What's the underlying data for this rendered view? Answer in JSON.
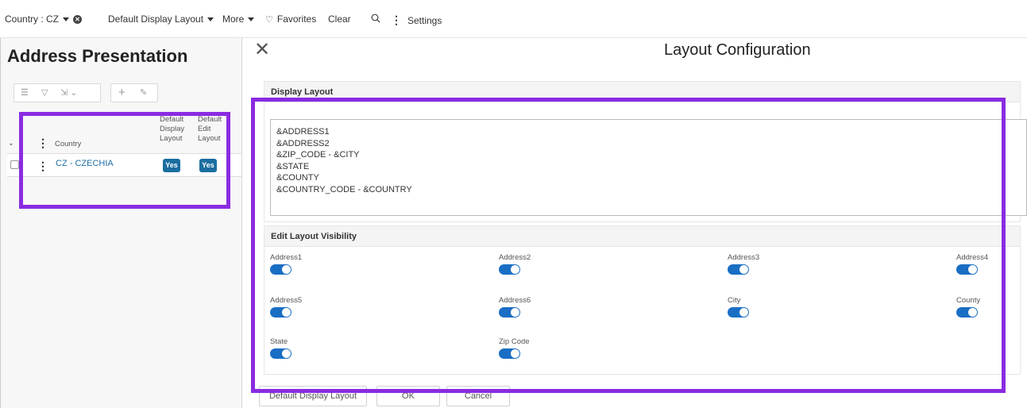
{
  "toolbar": {
    "country_filter": "Country : CZ",
    "layout_menu": "Default Display Layout",
    "more_menu": "More",
    "favorites": "Favorites",
    "clear": "Clear",
    "settings": "Settings"
  },
  "page": {
    "title": "Address Presentation"
  },
  "grid": {
    "columns": {
      "country": "Country",
      "default_display_layout": [
        "Default",
        "Display",
        "Layout"
      ],
      "default_edit_layout": [
        "Default",
        "Edit",
        "Layout"
      ]
    },
    "rows": [
      {
        "country": "CZ - CZECHIA",
        "default_display_layout": "Yes",
        "default_edit_layout": "Yes"
      }
    ]
  },
  "dialog": {
    "title": "Layout Configuration",
    "display_layout_header": "Display Layout",
    "display_layout_lines": [
      "&ADDRESS1",
      "&ADDRESS2",
      "&ZIP_CODE - &CITY",
      "&STATE",
      "&COUNTY",
      "&COUNTRY_CODE - &COUNTRY"
    ],
    "edit_visibility_header": "Edit Layout Visibility",
    "visibility": [
      {
        "label": "Address1",
        "enabled": true
      },
      {
        "label": "Address2",
        "enabled": true
      },
      {
        "label": "Address3",
        "enabled": true
      },
      {
        "label": "Address4",
        "enabled": true
      },
      {
        "label": "Address5",
        "enabled": true
      },
      {
        "label": "Address6",
        "enabled": true
      },
      {
        "label": "City",
        "enabled": true
      },
      {
        "label": "County",
        "enabled": true
      },
      {
        "label": "State",
        "enabled": true
      },
      {
        "label": "Zip Code",
        "enabled": true
      }
    ],
    "buttons": {
      "default_layout": "Default Display Layout",
      "ok": "OK",
      "cancel": "Cancel"
    }
  },
  "colors": {
    "accent": "#1a6ec4",
    "highlight": "#8a2be2",
    "link": "#1c6ea4"
  }
}
